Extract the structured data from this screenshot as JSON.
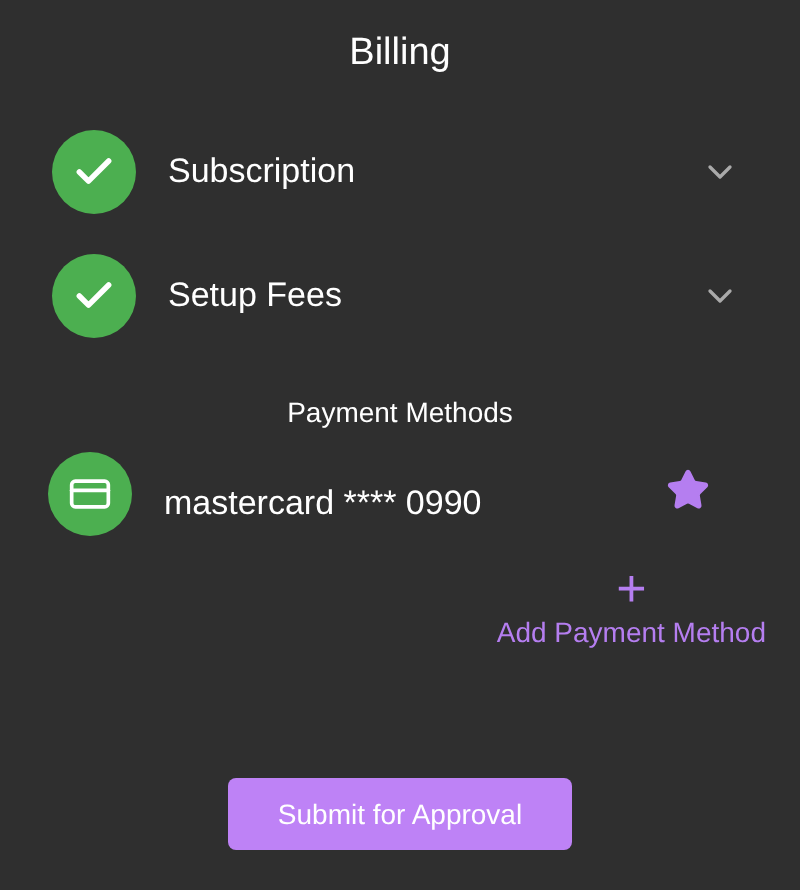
{
  "title": "Billing",
  "sections": [
    {
      "label": "Subscription",
      "completed": true,
      "expanded": false
    },
    {
      "label": "Setup Fees",
      "completed": true,
      "expanded": false
    }
  ],
  "payment_methods": {
    "heading": "Payment Methods",
    "items": [
      {
        "label": "mastercard **** 0990",
        "default": true
      }
    ],
    "add_action": {
      "icon_text": "+",
      "label": "Add Payment Method"
    }
  },
  "submit_button": {
    "label": "Submit for Approval"
  }
}
